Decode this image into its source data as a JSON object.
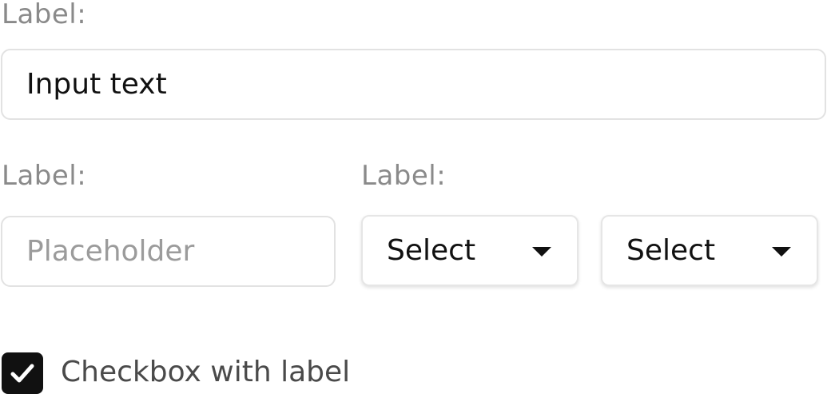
{
  "form": {
    "row1": {
      "label": "Label:",
      "input_value": "Input text"
    },
    "row2": {
      "left_label": "Label:",
      "right_label": "Label:",
      "text_placeholder": "Placeholder",
      "select_1": "Select",
      "select_2": "Select"
    },
    "checkbox": {
      "label": "Checkbox with label",
      "checked": true
    }
  },
  "colors": {
    "label_text": "#8a8a8a",
    "border": "#e2e2e2",
    "checkbox_fill": "#111111"
  }
}
